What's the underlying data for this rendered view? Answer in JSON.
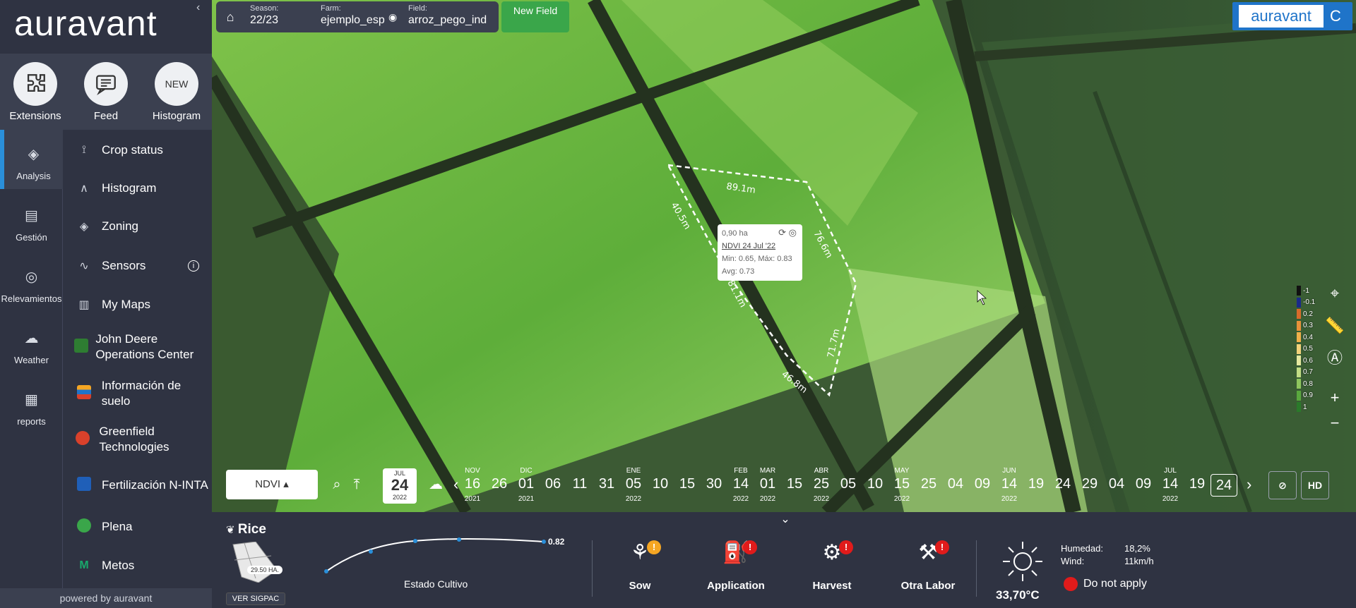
{
  "brand": {
    "name": "auravant",
    "collapse": "‹",
    "powered": "powered by auravant"
  },
  "quick": [
    {
      "label": "Extensions",
      "icon": "puzzle-icon",
      "glyph": "✚"
    },
    {
      "label": "Feed",
      "icon": "chat-icon",
      "glyph": "☰"
    },
    {
      "label": "Histogram",
      "icon": "new-badge",
      "glyph": "NEW"
    }
  ],
  "rail": [
    {
      "label": "Analysis",
      "icon": "layers-icon",
      "glyph": "◈",
      "active": true
    },
    {
      "label": "Gestión",
      "icon": "document-icon",
      "glyph": "▤"
    },
    {
      "label": "Relevamientos",
      "icon": "pin-icon",
      "glyph": "◎"
    },
    {
      "label": "Weather",
      "icon": "cloud-icon",
      "glyph": "☁"
    },
    {
      "label": "reports",
      "icon": "clipboard-icon",
      "glyph": "▦"
    }
  ],
  "menu": [
    {
      "label": "Crop status",
      "glyph": "⟟"
    },
    {
      "label": "Histogram",
      "glyph": "∧"
    },
    {
      "label": "Zoning",
      "glyph": "◈"
    },
    {
      "label": "Sensors",
      "glyph": "∿",
      "info": "i"
    },
    {
      "label": "My Maps",
      "glyph": "▥"
    },
    {
      "label": "John Deere Operations Center",
      "glyph": "■",
      "color": "#2e7d32"
    },
    {
      "label": "Información de suelo",
      "glyph": "≡",
      "color": "#f5a623"
    },
    {
      "label": "Greenfield Technologies",
      "glyph": "●",
      "color": "#d9412b"
    },
    {
      "label": "Fertilización N-INTA",
      "glyph": "■",
      "color": "#1f5fb8"
    },
    {
      "label": "Plena",
      "glyph": "✔",
      "color": "#3aa64a"
    },
    {
      "label": "Metos",
      "glyph": "M",
      "color": "#19a86b"
    }
  ],
  "topbar": {
    "season_label": "Season:",
    "season": "22/23",
    "farm_label": "Farm:",
    "farm": "ejemplo_esp",
    "field_label": "Field:",
    "field": "arroz_pego_ind",
    "new_field": "New Field"
  },
  "logo_badge": {
    "text": "auravant",
    "letter": "C"
  },
  "popup": {
    "area": "0,90 ha",
    "ndvi": "NDVI 24 Jul '22",
    "minmax": "Min: 0.65, Máx: 0.83",
    "avg": "Avg: 0.73"
  },
  "polygon_labels": [
    "89.1m",
    "40.5m",
    "76.6m",
    "71.7m",
    "46.8m",
    "81.1m"
  ],
  "legend": [
    {
      "v": "-1",
      "c": "#111111"
    },
    {
      "v": "-0.1",
      "c": "#1a2a8a"
    },
    {
      "v": "0.2",
      "c": "#d86a2a"
    },
    {
      "v": "0.3",
      "c": "#e8913a"
    },
    {
      "v": "0.4",
      "c": "#f0b04a"
    },
    {
      "v": "0.5",
      "c": "#f2d27a"
    },
    {
      "v": "0.6",
      "c": "#e6e8a0"
    },
    {
      "v": "0.7",
      "c": "#c2dc84"
    },
    {
      "v": "0.8",
      "c": "#8fc65e"
    },
    {
      "v": "0.9",
      "c": "#5aa83e"
    },
    {
      "v": "1",
      "c": "#2a7a2a"
    }
  ],
  "timeline": {
    "index": "NDVI",
    "date_month": "JUL",
    "date_day": "24",
    "date_year": "2022",
    "hd": "HD",
    "dates": [
      {
        "mon": "NOV",
        "day": "16",
        "yr": "2021"
      },
      {
        "mon": "",
        "day": "26",
        "yr": ""
      },
      {
        "mon": "DIC",
        "day": "01",
        "yr": "2021"
      },
      {
        "mon": "",
        "day": "06",
        "yr": ""
      },
      {
        "mon": "",
        "day": "11",
        "yr": ""
      },
      {
        "mon": "",
        "day": "31",
        "yr": ""
      },
      {
        "mon": "ENE",
        "day": "05",
        "yr": "2022"
      },
      {
        "mon": "",
        "day": "10",
        "yr": ""
      },
      {
        "mon": "",
        "day": "15",
        "yr": ""
      },
      {
        "mon": "",
        "day": "30",
        "yr": ""
      },
      {
        "mon": "FEB",
        "day": "14",
        "yr": "2022"
      },
      {
        "mon": "MAR",
        "day": "01",
        "yr": "2022"
      },
      {
        "mon": "",
        "day": "15",
        "yr": ""
      },
      {
        "mon": "ABR",
        "day": "25",
        "yr": "2022"
      },
      {
        "mon": "",
        "day": "05",
        "yr": ""
      },
      {
        "mon": "",
        "day": "10",
        "yr": ""
      },
      {
        "mon": "MAY",
        "day": "15",
        "yr": "2022"
      },
      {
        "mon": "",
        "day": "25",
        "yr": ""
      },
      {
        "mon": "",
        "day": "04",
        "yr": ""
      },
      {
        "mon": "",
        "day": "09",
        "yr": ""
      },
      {
        "mon": "JUN",
        "day": "14",
        "yr": "2022"
      },
      {
        "mon": "",
        "day": "19",
        "yr": ""
      },
      {
        "mon": "",
        "day": "24",
        "yr": ""
      },
      {
        "mon": "",
        "day": "29",
        "yr": ""
      },
      {
        "mon": "",
        "day": "04",
        "yr": ""
      },
      {
        "mon": "",
        "day": "09",
        "yr": ""
      },
      {
        "mon": "JUL",
        "day": "14",
        "yr": "2022"
      },
      {
        "mon": "",
        "day": "19",
        "yr": ""
      },
      {
        "mon": "",
        "day": "24",
        "yr": "",
        "selected": true
      }
    ]
  },
  "crop": {
    "name": "Rice",
    "hectares": "29.50 HA.",
    "sigpac": "VER SIGPAC",
    "curve_value": "0.82",
    "curve_label": "Estado Cultivo"
  },
  "actions": [
    {
      "label": "Sow",
      "icon": "sow-icon",
      "warn_color": "#f5a623"
    },
    {
      "label": "Application",
      "icon": "sprayer-icon",
      "warn_color": "#e01b1b"
    },
    {
      "label": "Harvest",
      "icon": "harvester-icon",
      "warn_color": "#e01b1b"
    },
    {
      "label": "Otra Labor",
      "icon": "shovel-icon",
      "warn_color": "#e01b1b"
    }
  ],
  "weather": {
    "temperature": "33,70°C",
    "humidity_label": "Humedad:",
    "humidity": "18,2%",
    "wind_label": "Wind:",
    "wind": "11km/h",
    "apply": "Do not apply"
  }
}
